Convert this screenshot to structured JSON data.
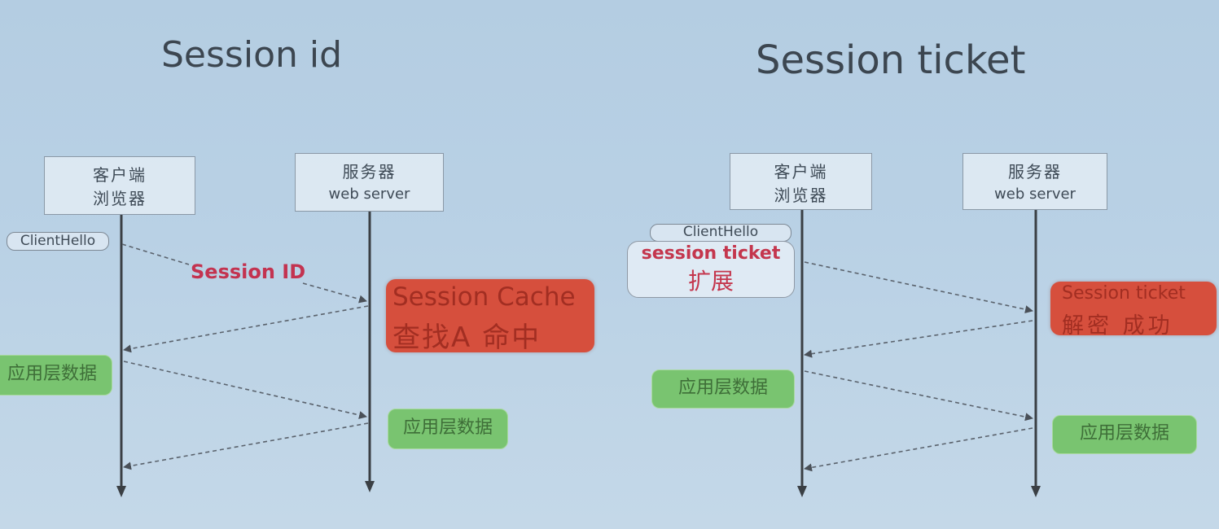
{
  "titles": {
    "left": "Session id",
    "right": "Session ticket"
  },
  "left_diagram": {
    "client": {
      "line1": "客户端",
      "line2": "浏览器"
    },
    "server": {
      "line1": "服务器",
      "line2": "web server"
    },
    "client_hello": "ClientHello",
    "session_id_label": "Session ID",
    "cache_box": {
      "line1": "Session Cache",
      "line2": "查找A 命中"
    },
    "app_data_client": "应用层数据",
    "app_data_server": "应用层数据"
  },
  "right_diagram": {
    "client": {
      "line1": "客户端",
      "line2": "浏览器"
    },
    "server": {
      "line1": "服务器",
      "line2": "web server"
    },
    "client_hello": "ClientHello",
    "ticket_extension": {
      "line1": "session ticket",
      "line2": "扩展"
    },
    "ticket_box": {
      "line1": "Session ticket",
      "line2": "解密 成功"
    },
    "app_data_client": "应用层数据",
    "app_data_server": "应用层数据"
  },
  "colors": {
    "background": "#b9d1e5",
    "red_box": "#d64f3d",
    "green_box": "#79c470",
    "label_red": "#c33350",
    "line": "#3a3f44"
  }
}
